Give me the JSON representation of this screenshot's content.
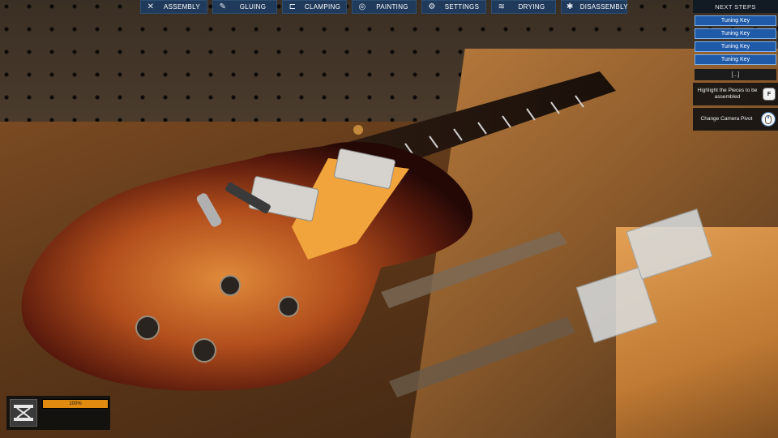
{
  "toolbar": {
    "tabs": [
      {
        "label": "ASSEMBLY",
        "icon": "wrench-screwdriver-icon"
      },
      {
        "label": "GLUING",
        "icon": "glue-brush-icon"
      },
      {
        "label": "CLAMPING",
        "icon": "clamp-icon"
      },
      {
        "label": "PAINTING",
        "icon": "paint-palette-icon"
      },
      {
        "label": "SETTINGS",
        "icon": "gears-icon"
      },
      {
        "label": "DRYING",
        "icon": "heat-waves-icon"
      },
      {
        "label": "DISASSEMBLY",
        "icon": "gear-icon"
      }
    ]
  },
  "next_steps": {
    "title": "NEXT STEPS",
    "steps": [
      "Tuning Key",
      "Tuning Key",
      "Tuning Key",
      "Tuning Key"
    ],
    "more": "[...]",
    "highlight_hint": "Highlight the Pieces to be assembled",
    "highlight_key": "F",
    "camera_hint": "Change Camera Pivot"
  },
  "tool": {
    "icon": "clamp-tool-icon",
    "progress": 1.0,
    "progress_label": "100%"
  },
  "colors": {
    "tab_bg": "#1f3a5a",
    "step_bg": "#1f5aa8",
    "progress_fill": "#e08a10"
  }
}
